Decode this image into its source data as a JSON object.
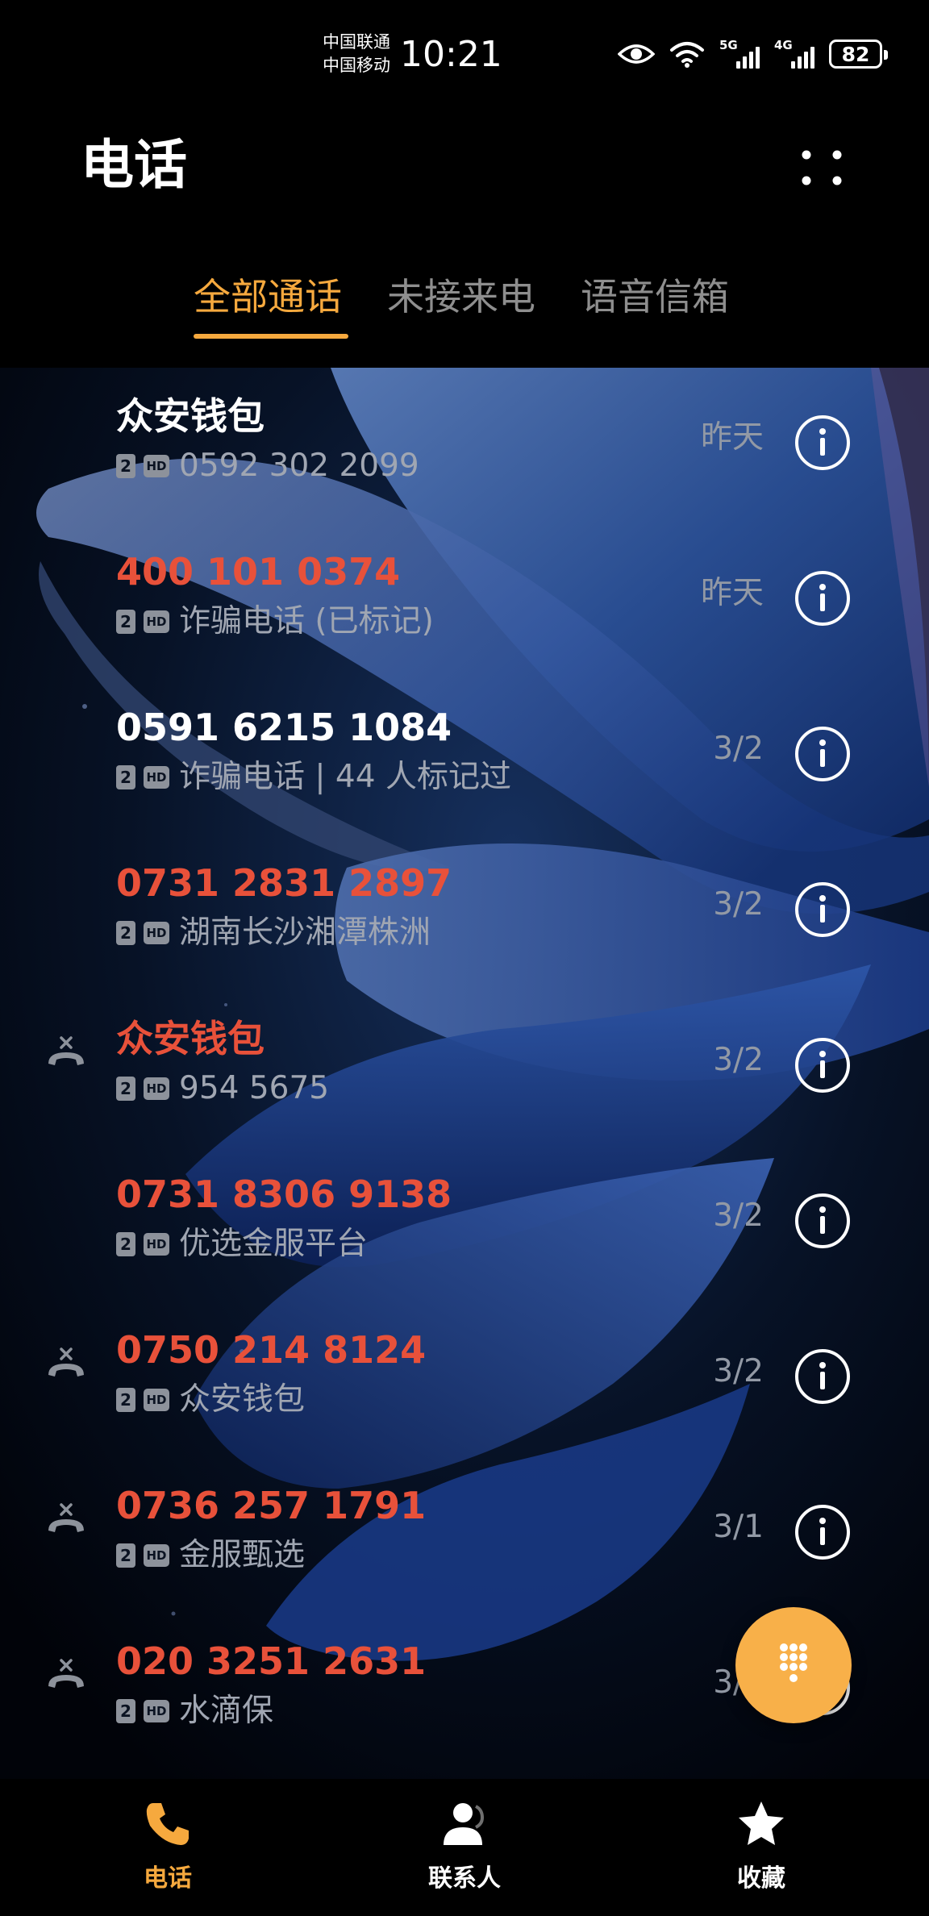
{
  "status_bar": {
    "carrier_1": "中国联通",
    "carrier_2": "中国移动",
    "time": "10:21",
    "signal_1": "5G",
    "signal_2": "4G",
    "battery": "82",
    "icons": [
      "eye-icon",
      "wifi-icon",
      "signal-5g-icon",
      "signal-4g-icon",
      "battery-icon"
    ]
  },
  "header": {
    "title": "电话"
  },
  "tabs": [
    {
      "label": "全部通话",
      "active": true
    },
    {
      "label": "未接来电",
      "active": false
    },
    {
      "label": "语音信箱",
      "active": false
    }
  ],
  "badges": {
    "sim": "2",
    "hd": "HD"
  },
  "calls": [
    {
      "name": "众安钱包",
      "detail": "0592 302 2099",
      "time": "昨天",
      "missed": false
    },
    {
      "name": "400 101 0374",
      "detail": "诈骗电话 (已标记)",
      "time": "昨天",
      "missed": true
    },
    {
      "name": "0591 6215 1084",
      "detail": "诈骗电话 | 44 人标记过",
      "time": "3/2",
      "missed": false
    },
    {
      "name": "0731 2831 2897",
      "detail": "湖南长沙湘潭株洲",
      "time": "3/2",
      "missed": true
    },
    {
      "name": "众安钱包",
      "detail": "954 5675",
      "time": "3/2",
      "missed": true,
      "rejected": true
    },
    {
      "name": "0731 8306 9138",
      "detail": "优选金服平台",
      "time": "3/2",
      "missed": true
    },
    {
      "name": "0750 214 8124",
      "detail": "众安钱包",
      "time": "3/2",
      "missed": true,
      "rejected": true
    },
    {
      "name": "0736 257 1791",
      "detail": "金服甄选",
      "time": "3/1",
      "missed": true,
      "rejected": true
    },
    {
      "name": "020 3251 2631",
      "detail": "水滴保",
      "time": "3/1",
      "missed": true,
      "rejected": true
    }
  ],
  "bottom_nav": [
    {
      "label": "电话",
      "icon": "phone-icon",
      "active": true
    },
    {
      "label": "联系人",
      "icon": "contacts-icon",
      "active": false
    },
    {
      "label": "收藏",
      "icon": "star-icon",
      "active": false
    }
  ],
  "colors": {
    "accent": "#f6a93e",
    "missed": "#e8513a",
    "secondary_text": "#a0a6b2",
    "fab": "#f8b049"
  }
}
